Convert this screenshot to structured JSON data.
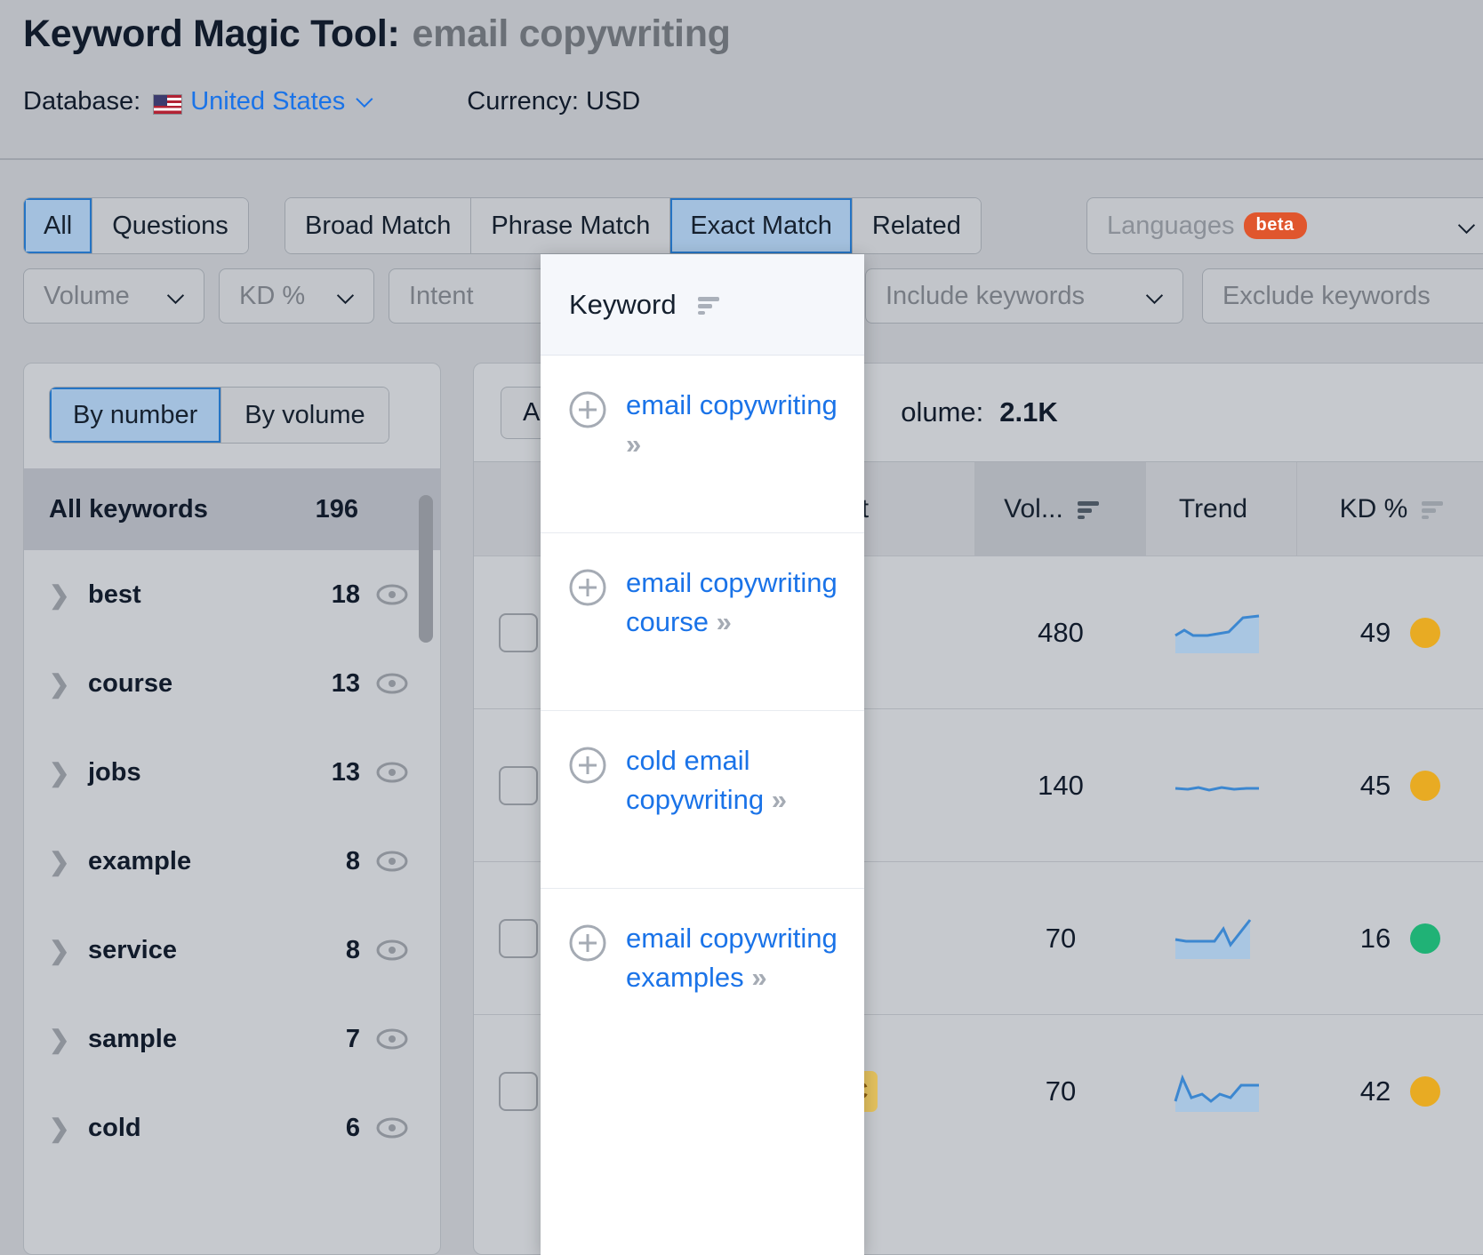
{
  "header": {
    "title_main": "Keyword Magic Tool:",
    "title_query": "email copywriting",
    "database_label": "Database:",
    "database_value": "United States",
    "database_flag": "us-flag-icon",
    "currency_text": "Currency: USD",
    "chevron": "chevron-down-icon"
  },
  "filters": {
    "match_tabs": [
      {
        "label": "All",
        "active": true
      },
      {
        "label": "Questions",
        "active": false
      }
    ],
    "match_tabs2": [
      {
        "label": "Broad Match",
        "active": false
      },
      {
        "label": "Phrase Match",
        "active": false
      },
      {
        "label": "Exact Match",
        "active": true
      },
      {
        "label": "Related",
        "active": false
      }
    ],
    "languages": {
      "label": "Languages",
      "badge": "beta"
    },
    "dropdowns": [
      {
        "label": "Volume",
        "chevron": true
      },
      {
        "label": "KD %",
        "chevron": true
      },
      {
        "label": "Intent",
        "chevron": false
      },
      {
        "label": "Include keywords",
        "chevron": true
      },
      {
        "label": "Exclude keywords",
        "chevron": false
      }
    ]
  },
  "sidebar": {
    "toggle": [
      {
        "label": "By number",
        "active": true
      },
      {
        "label": "By volume",
        "active": false
      }
    ],
    "all_keywords": {
      "label": "All keywords",
      "count": "196"
    },
    "groups": [
      {
        "label": "best",
        "count": "18"
      },
      {
        "label": "course",
        "count": "13"
      },
      {
        "label": "jobs",
        "count": "13"
      },
      {
        "label": "example",
        "count": "8"
      },
      {
        "label": "service",
        "count": "8"
      },
      {
        "label": "sample",
        "count": "7"
      },
      {
        "label": "cold",
        "count": "6"
      }
    ]
  },
  "table": {
    "summary": {
      "all_tag": "All",
      "volume_label": "olume:",
      "volume_value": "2.1K"
    },
    "columns": {
      "keyword": "Keyword",
      "intent": "tent",
      "volume": "Vol...",
      "trend": "Trend",
      "kd": "KD %"
    },
    "rows": [
      {
        "volume": "480",
        "kd": "49",
        "kd_color": "#e8ab23",
        "intent_color": "#4f9fd1",
        "intent_badge": ""
      },
      {
        "volume": "140",
        "kd": "45",
        "kd_color": "#e8ab23",
        "intent_color": "#d4b02f",
        "intent_badge": ""
      },
      {
        "volume": "70",
        "kd": "16",
        "kd_color": "#20b276",
        "intent_color": "#4f9fd1",
        "intent_badge": ""
      },
      {
        "volume": "70",
        "kd": "42",
        "kd_color": "#e8ab23",
        "intent_color": "#4f9fd1",
        "intent_badge": "C"
      }
    ]
  },
  "keyword_popup": {
    "header_title": "Keyword",
    "sort_icon": "sort-icon",
    "items": [
      {
        "text": "email copywriting",
        "plus": "plus-circle-icon",
        "chevrons": "»"
      },
      {
        "text": "email copywriting course",
        "plus": "plus-circle-icon",
        "chevrons": "»"
      },
      {
        "text": "cold email copywriting",
        "plus": "plus-circle-icon",
        "chevrons": "»"
      },
      {
        "text": "email copywriting examples",
        "plus": "plus-circle-icon",
        "chevrons": "»"
      }
    ]
  },
  "colors": {
    "accent_blue": "#1a73e8",
    "selected_tab": "#a3c0de",
    "beta_orange": "#e0562d",
    "kd_green": "#20b276",
    "kd_yellow": "#e8ab23"
  }
}
